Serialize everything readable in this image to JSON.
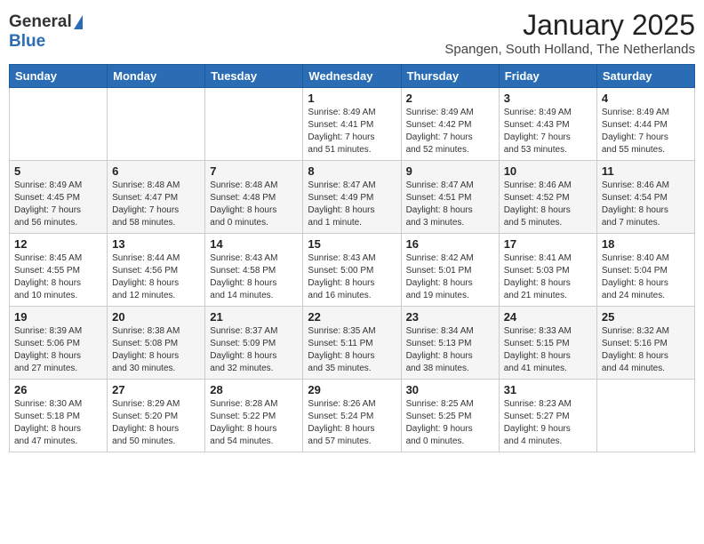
{
  "header": {
    "logo_general": "General",
    "logo_blue": "Blue",
    "month_title": "January 2025",
    "location": "Spangen, South Holland, The Netherlands"
  },
  "weekdays": [
    "Sunday",
    "Monday",
    "Tuesday",
    "Wednesday",
    "Thursday",
    "Friday",
    "Saturday"
  ],
  "weeks": [
    [
      {
        "day": "",
        "info": ""
      },
      {
        "day": "",
        "info": ""
      },
      {
        "day": "",
        "info": ""
      },
      {
        "day": "1",
        "info": "Sunrise: 8:49 AM\nSunset: 4:41 PM\nDaylight: 7 hours\nand 51 minutes."
      },
      {
        "day": "2",
        "info": "Sunrise: 8:49 AM\nSunset: 4:42 PM\nDaylight: 7 hours\nand 52 minutes."
      },
      {
        "day": "3",
        "info": "Sunrise: 8:49 AM\nSunset: 4:43 PM\nDaylight: 7 hours\nand 53 minutes."
      },
      {
        "day": "4",
        "info": "Sunrise: 8:49 AM\nSunset: 4:44 PM\nDaylight: 7 hours\nand 55 minutes."
      }
    ],
    [
      {
        "day": "5",
        "info": "Sunrise: 8:49 AM\nSunset: 4:45 PM\nDaylight: 7 hours\nand 56 minutes."
      },
      {
        "day": "6",
        "info": "Sunrise: 8:48 AM\nSunset: 4:47 PM\nDaylight: 7 hours\nand 58 minutes."
      },
      {
        "day": "7",
        "info": "Sunrise: 8:48 AM\nSunset: 4:48 PM\nDaylight: 8 hours\nand 0 minutes."
      },
      {
        "day": "8",
        "info": "Sunrise: 8:47 AM\nSunset: 4:49 PM\nDaylight: 8 hours\nand 1 minute."
      },
      {
        "day": "9",
        "info": "Sunrise: 8:47 AM\nSunset: 4:51 PM\nDaylight: 8 hours\nand 3 minutes."
      },
      {
        "day": "10",
        "info": "Sunrise: 8:46 AM\nSunset: 4:52 PM\nDaylight: 8 hours\nand 5 minutes."
      },
      {
        "day": "11",
        "info": "Sunrise: 8:46 AM\nSunset: 4:54 PM\nDaylight: 8 hours\nand 7 minutes."
      }
    ],
    [
      {
        "day": "12",
        "info": "Sunrise: 8:45 AM\nSunset: 4:55 PM\nDaylight: 8 hours\nand 10 minutes."
      },
      {
        "day": "13",
        "info": "Sunrise: 8:44 AM\nSunset: 4:56 PM\nDaylight: 8 hours\nand 12 minutes."
      },
      {
        "day": "14",
        "info": "Sunrise: 8:43 AM\nSunset: 4:58 PM\nDaylight: 8 hours\nand 14 minutes."
      },
      {
        "day": "15",
        "info": "Sunrise: 8:43 AM\nSunset: 5:00 PM\nDaylight: 8 hours\nand 16 minutes."
      },
      {
        "day": "16",
        "info": "Sunrise: 8:42 AM\nSunset: 5:01 PM\nDaylight: 8 hours\nand 19 minutes."
      },
      {
        "day": "17",
        "info": "Sunrise: 8:41 AM\nSunset: 5:03 PM\nDaylight: 8 hours\nand 21 minutes."
      },
      {
        "day": "18",
        "info": "Sunrise: 8:40 AM\nSunset: 5:04 PM\nDaylight: 8 hours\nand 24 minutes."
      }
    ],
    [
      {
        "day": "19",
        "info": "Sunrise: 8:39 AM\nSunset: 5:06 PM\nDaylight: 8 hours\nand 27 minutes."
      },
      {
        "day": "20",
        "info": "Sunrise: 8:38 AM\nSunset: 5:08 PM\nDaylight: 8 hours\nand 30 minutes."
      },
      {
        "day": "21",
        "info": "Sunrise: 8:37 AM\nSunset: 5:09 PM\nDaylight: 8 hours\nand 32 minutes."
      },
      {
        "day": "22",
        "info": "Sunrise: 8:35 AM\nSunset: 5:11 PM\nDaylight: 8 hours\nand 35 minutes."
      },
      {
        "day": "23",
        "info": "Sunrise: 8:34 AM\nSunset: 5:13 PM\nDaylight: 8 hours\nand 38 minutes."
      },
      {
        "day": "24",
        "info": "Sunrise: 8:33 AM\nSunset: 5:15 PM\nDaylight: 8 hours\nand 41 minutes."
      },
      {
        "day": "25",
        "info": "Sunrise: 8:32 AM\nSunset: 5:16 PM\nDaylight: 8 hours\nand 44 minutes."
      }
    ],
    [
      {
        "day": "26",
        "info": "Sunrise: 8:30 AM\nSunset: 5:18 PM\nDaylight: 8 hours\nand 47 minutes."
      },
      {
        "day": "27",
        "info": "Sunrise: 8:29 AM\nSunset: 5:20 PM\nDaylight: 8 hours\nand 50 minutes."
      },
      {
        "day": "28",
        "info": "Sunrise: 8:28 AM\nSunset: 5:22 PM\nDaylight: 8 hours\nand 54 minutes."
      },
      {
        "day": "29",
        "info": "Sunrise: 8:26 AM\nSunset: 5:24 PM\nDaylight: 8 hours\nand 57 minutes."
      },
      {
        "day": "30",
        "info": "Sunrise: 8:25 AM\nSunset: 5:25 PM\nDaylight: 9 hours\nand 0 minutes."
      },
      {
        "day": "31",
        "info": "Sunrise: 8:23 AM\nSunset: 5:27 PM\nDaylight: 9 hours\nand 4 minutes."
      },
      {
        "day": "",
        "info": ""
      }
    ]
  ]
}
